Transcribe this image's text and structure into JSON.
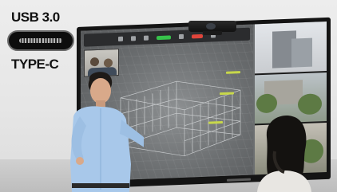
{
  "badge": {
    "line1": "USB 3.0",
    "line2": "TYPE-C",
    "connector_icon": "usb-type-c-port-icon"
  },
  "colors": {
    "background": "#e8e8e8",
    "display_bezel": "#141414",
    "screen": "#6b6e70",
    "presenter_shirt": "#a8c8ea",
    "toolbar_green": "#37c34b",
    "toolbar_red": "#e0453b"
  },
  "scene": {
    "device": "interactive-display-with-webcam",
    "people": [
      "presenter",
      "listener"
    ],
    "screen_content": [
      "meeting-toolbar",
      "video-thumbnail",
      "architectural-wireframe",
      "building-photo-panel"
    ]
  }
}
